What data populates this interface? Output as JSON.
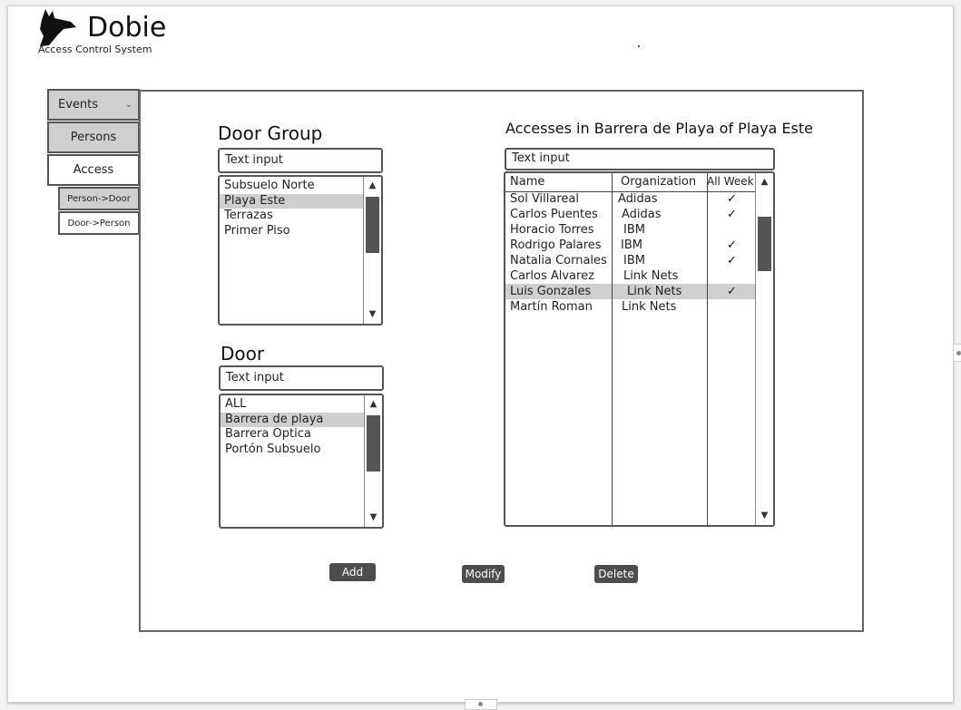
{
  "app": {
    "title": "Dobie",
    "subtitle": "Access Control System"
  },
  "sidebar": {
    "items": [
      {
        "label": "Events"
      },
      {
        "label": "Persons"
      },
      {
        "label": "Access"
      },
      {
        "label": "Person->Door"
      },
      {
        "label": "Door->Person"
      }
    ]
  },
  "door_group": {
    "title": "Door Group",
    "search_placeholder": "Text input",
    "items": [
      "Subsuelo Norte",
      "Playa Este",
      "Terrazas",
      "Primer Piso"
    ],
    "selected": "Playa Este"
  },
  "door": {
    "title": "Door",
    "search_placeholder": "Text input",
    "items": [
      "ALL",
      "Barrera de playa",
      "Barrera Optica",
      "Portón Subsuelo"
    ],
    "selected": "Barrera de playa"
  },
  "accesses": {
    "title": "Accesses in Barrera de Playa of Playa Este",
    "search_placeholder": "Text input",
    "columns": [
      "Name",
      "Organization",
      "All Week"
    ],
    "rows": [
      {
        "name": "Sol Villareal",
        "org": "Adidas",
        "all_week": "✓"
      },
      {
        "name": "Carlos Puentes",
        "org": "Adidas",
        "all_week": "✓"
      },
      {
        "name": "Horacio Torres",
        "org": "IBM",
        "all_week": ""
      },
      {
        "name": "Rodrigo Palares",
        "org": "IBM",
        "all_week": "✓"
      },
      {
        "name": "Natalia Cornales",
        "org": "IBM",
        "all_week": "✓"
      },
      {
        "name": "Carlos Alvarez",
        "org": "Link Nets",
        "all_week": ""
      },
      {
        "name": "Luis Gonzales",
        "org": "Link Nets",
        "all_week": "✓"
      },
      {
        "name": "Martín Roman",
        "org": "Link Nets",
        "all_week": ""
      }
    ],
    "selected_row": 6
  },
  "actions": {
    "add": "Add",
    "modify": "Modify",
    "delete": "Delete"
  },
  "colors": {
    "selection": "#cfcfcf",
    "button": "#4d4d4d",
    "border": "#555555"
  }
}
